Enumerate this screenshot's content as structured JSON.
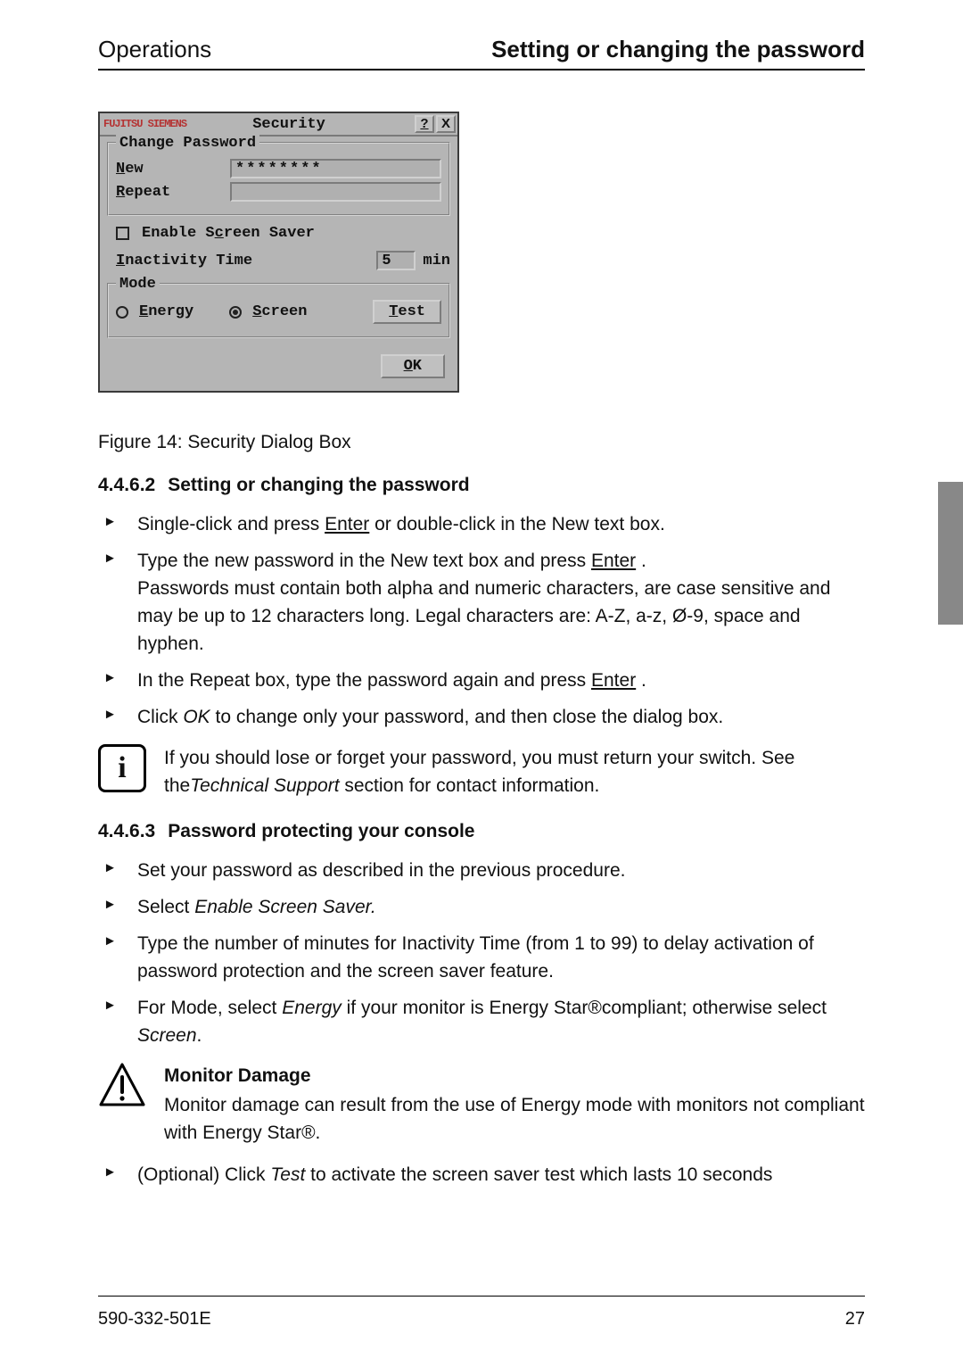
{
  "header": {
    "left": "Operations",
    "right": "Setting or changing the password"
  },
  "dialog": {
    "logo": "FUJITSU SIEMENS",
    "title": "Security",
    "change_password_legend": "Change Password",
    "new_label_pre": "N",
    "new_label_post": "ew",
    "new_value": "********",
    "repeat_label_pre": "R",
    "repeat_label_post": "epeat",
    "screensaver_label_pre": "Enable S",
    "screensaver_label_u": "c",
    "screensaver_label_post": "reen Saver",
    "inactivity_label_pre": "I",
    "inactivity_label_post": "nactivity Time",
    "inactivity_value": "5",
    "inactivity_unit": "min",
    "mode_legend": "Mode",
    "energy_pre": "E",
    "energy_post": "nergy",
    "screen_pre": "S",
    "screen_post": "creen",
    "test_pre": "T",
    "test_post": "est",
    "ok_pre": "O",
    "ok_post": "K",
    "help": "?",
    "close": "X"
  },
  "figure_caption": "Figure 14: Security Dialog Box",
  "sect1": {
    "num": "4.4.6.2",
    "title": "Setting or changing the password",
    "steps": {
      "s1a": "Single-click and press ",
      "s1b": "Enter",
      "s1c": " or double-click in the New text box.",
      "s2a": "Type the new password in the New text box and press ",
      "s2b": "Enter",
      "s2c": " .",
      "s2d": "Passwords must contain both alpha and numeric characters, are case sensitive and may be up to 12 characters long. Legal characters are: A-Z, a-z, Ø-9, space and hyphen.",
      "s3a": "In the Repeat box, type the password again and press ",
      "s3b": "Enter",
      "s3c": " .",
      "s4a": "Click ",
      "s4b": "OK",
      "s4c": " to change only your password, and then close the dialog box."
    }
  },
  "info_callout": {
    "line1": "If you should lose or forget your password, you must return your switch. See the",
    "tech": "Technical Support",
    "line2": " section for contact information."
  },
  "sect2": {
    "num": "4.4.6.3",
    "title": "Password protecting your console",
    "steps": {
      "s1": "Set your password as described in the previous procedure.",
      "s2a": "Select ",
      "s2b": "Enable Screen Saver.",
      "s3": "Type the number of minutes for Inactivity Time (from 1 to 99) to delay activation of password protection and the screen saver feature.",
      "s4a": "For Mode, select ",
      "s4b": "Energy",
      "s4c": " if your monitor is Energy Star®compliant; otherwise select ",
      "s4d": "Screen",
      "s4e": "."
    }
  },
  "warn_callout": {
    "title": "Monitor Damage",
    "body": "Monitor damage can result from the use of Energy mode with monitors not compliant with Energy Star®."
  },
  "step_optional": {
    "a": "(Optional) Click ",
    "b": "Test",
    "c": " to activate the screen saver test which lasts 10 seconds"
  },
  "footer": {
    "left": "590-332-501E",
    "right": "27"
  }
}
